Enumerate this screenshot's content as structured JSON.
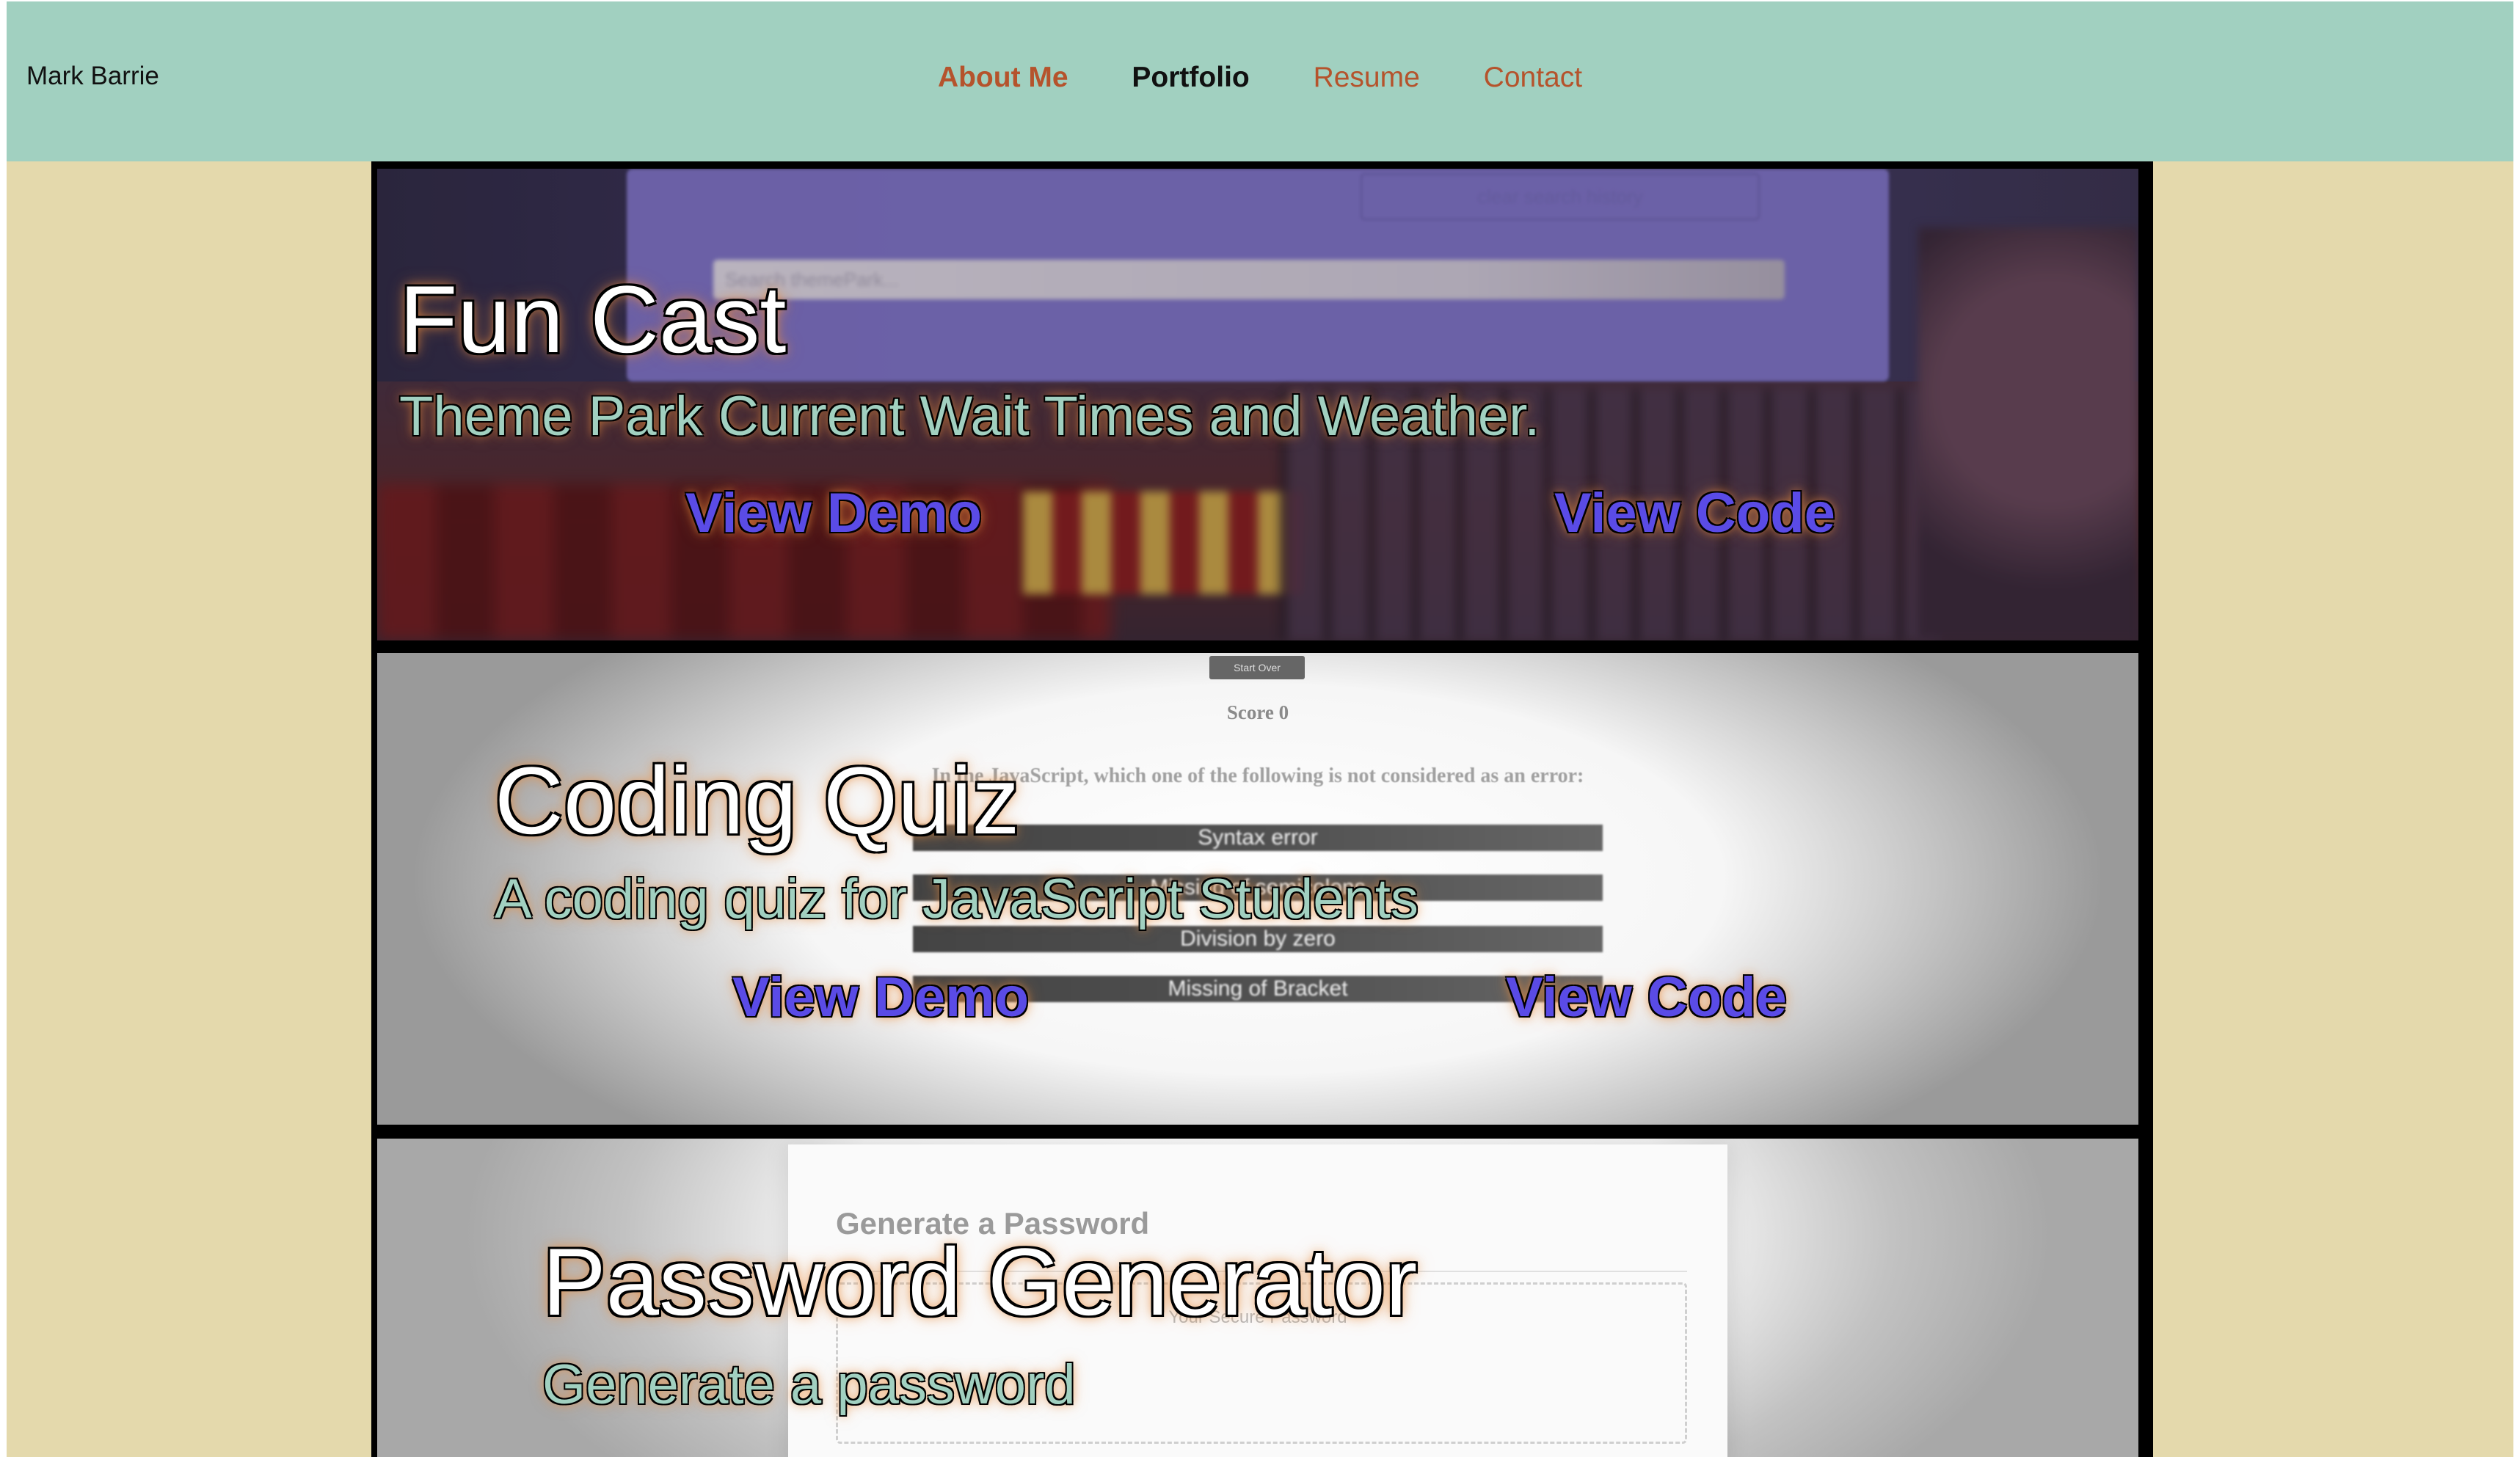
{
  "nav": {
    "brand": "Mark Barrie",
    "links": [
      {
        "label": "About Me"
      },
      {
        "label": "Portfolio"
      },
      {
        "label": "Resume"
      },
      {
        "label": "Contact"
      }
    ]
  },
  "projects": [
    {
      "title": "Fun Cast",
      "description": "Theme Park Current Wait Times and Weather.",
      "demo_label": "View Demo",
      "code_label": "View Code",
      "screenshot": {
        "clear_button": "clear search history",
        "search_placeholder": "Search themePark..."
      }
    },
    {
      "title": "Coding Quiz",
      "description": "A coding quiz for JavaScript Students",
      "demo_label": "View Demo",
      "code_label": "View Code",
      "screenshot": {
        "start_over": "Start Over",
        "score": "Score 0",
        "question": "In the JavaScript, which one of the following is not considered as an error:",
        "answers": [
          "Syntax error",
          "Missing of semicolons",
          "Division by zero",
          "Missing of Bracket"
        ]
      }
    },
    {
      "title": "Password Generator",
      "description": "Generate a password",
      "screenshot": {
        "heading": "Generate a Password",
        "placeholder": "Your Secure Password"
      }
    }
  ],
  "colors": {
    "navbar_bg": "#a1d0c0",
    "page_bg": "#e4d9ac",
    "nav_link": "#b5532c",
    "link_blue": "#5a4be6"
  }
}
